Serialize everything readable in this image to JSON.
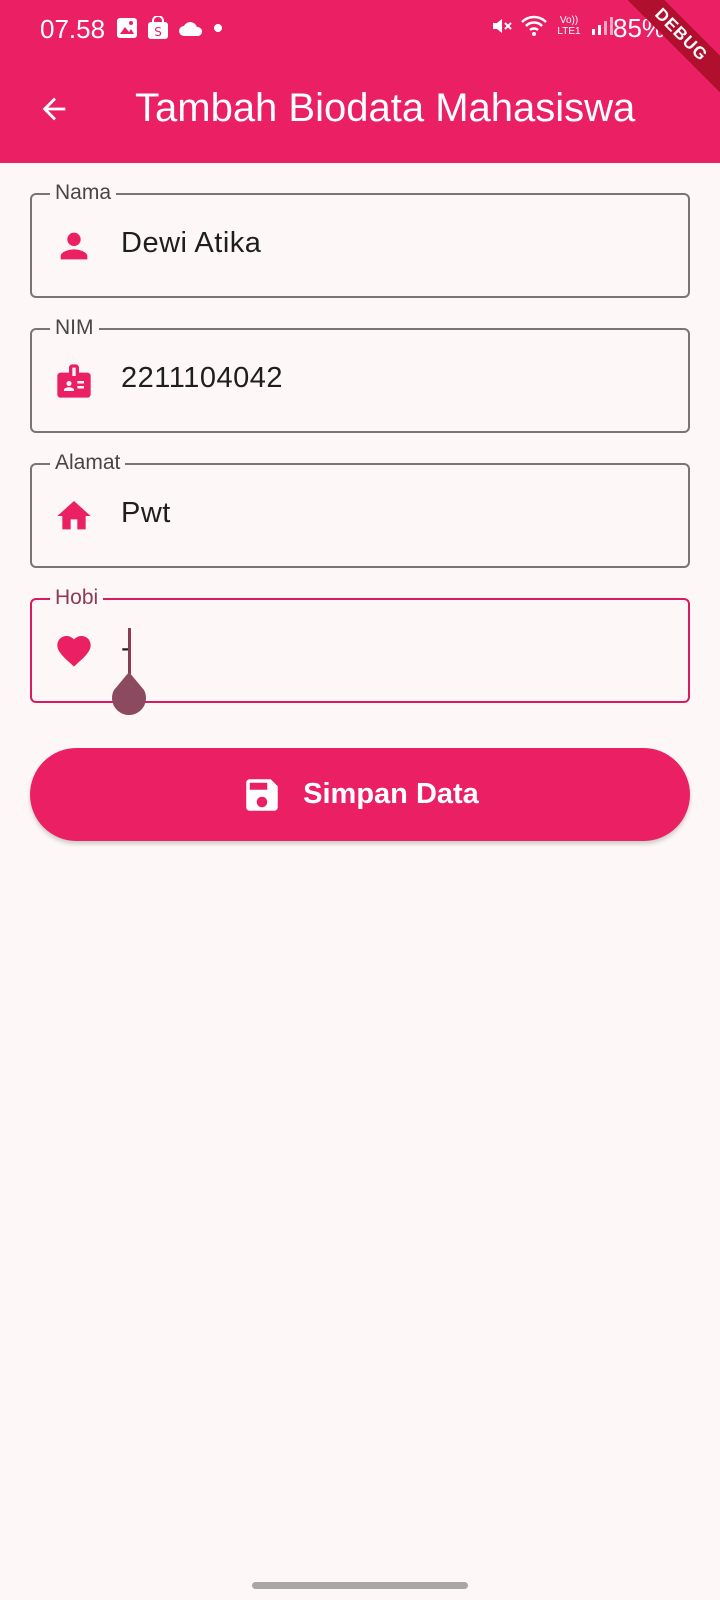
{
  "status_bar": {
    "time": "07.58",
    "battery": "85%",
    "network_label": "Vo)) LTE1"
  },
  "debug_banner": "DEBUG",
  "app_bar": {
    "title": "Tambah Biodata Mahasiswa",
    "back_icon": "arrow-back-icon"
  },
  "form": {
    "nama": {
      "label": "Nama",
      "value": "Dewi Atika",
      "icon": "person-icon"
    },
    "nim": {
      "label": "NIM",
      "value": "2211104042",
      "icon": "badge-icon"
    },
    "alamat": {
      "label": "Alamat",
      "value": "Pwt",
      "icon": "home-icon"
    },
    "hobi": {
      "label": "Hobi",
      "value": "-",
      "icon": "heart-icon"
    }
  },
  "save_button": {
    "label": "Simpan Data",
    "icon": "save-icon"
  },
  "colors": {
    "primary": "#EB1F63",
    "background": "#FDF7F7",
    "focus_label": "#8C3B57"
  }
}
